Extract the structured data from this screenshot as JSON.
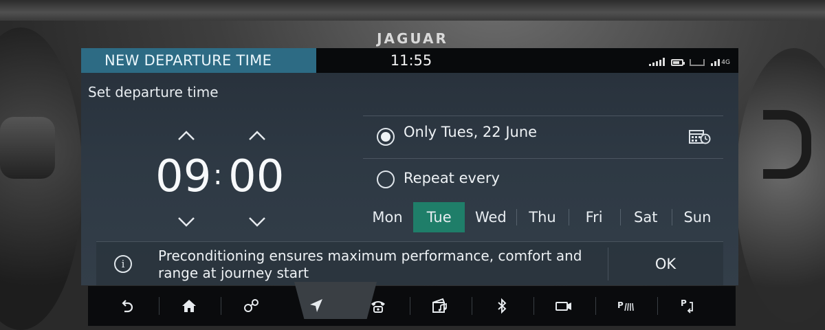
{
  "brand": "JAGUAR",
  "header": {
    "title": "NEW DEPARTURE TIME",
    "clock": "11:55",
    "network": "4G"
  },
  "subtitle": "Set departure time",
  "time": {
    "hours": "09",
    "separator": ":",
    "minutes": "00"
  },
  "options": {
    "only": {
      "label": "Only Tues, 22 June",
      "selected": true
    },
    "repeat": {
      "label": "Repeat every",
      "selected": false
    }
  },
  "days": [
    {
      "label": "Mon",
      "selected": false
    },
    {
      "label": "Tue",
      "selected": true
    },
    {
      "label": "Wed",
      "selected": false
    },
    {
      "label": "Thu",
      "selected": false
    },
    {
      "label": "Fri",
      "selected": false
    },
    {
      "label": "Sat",
      "selected": false
    },
    {
      "label": "Sun",
      "selected": false
    }
  ],
  "info": {
    "text": "Preconditioning ensures maximum performance, comfort and range at journey start",
    "ok_label": "OK"
  },
  "nav": [
    {
      "icon": "back-arrow-icon"
    },
    {
      "icon": "home-icon"
    },
    {
      "icon": "connected-dots-icon"
    },
    {
      "icon": "navigation-icon"
    },
    {
      "icon": "phone-icon"
    },
    {
      "icon": "media-icon"
    },
    {
      "icon": "bluetooth-icon"
    },
    {
      "icon": "camera-icon"
    },
    {
      "icon": "park-assist-icon"
    },
    {
      "icon": "park-exit-icon"
    }
  ],
  "colors": {
    "title_tab": "#2d6b84",
    "selected_day": "#1f7e69",
    "screen_bg": "#2e3944"
  }
}
